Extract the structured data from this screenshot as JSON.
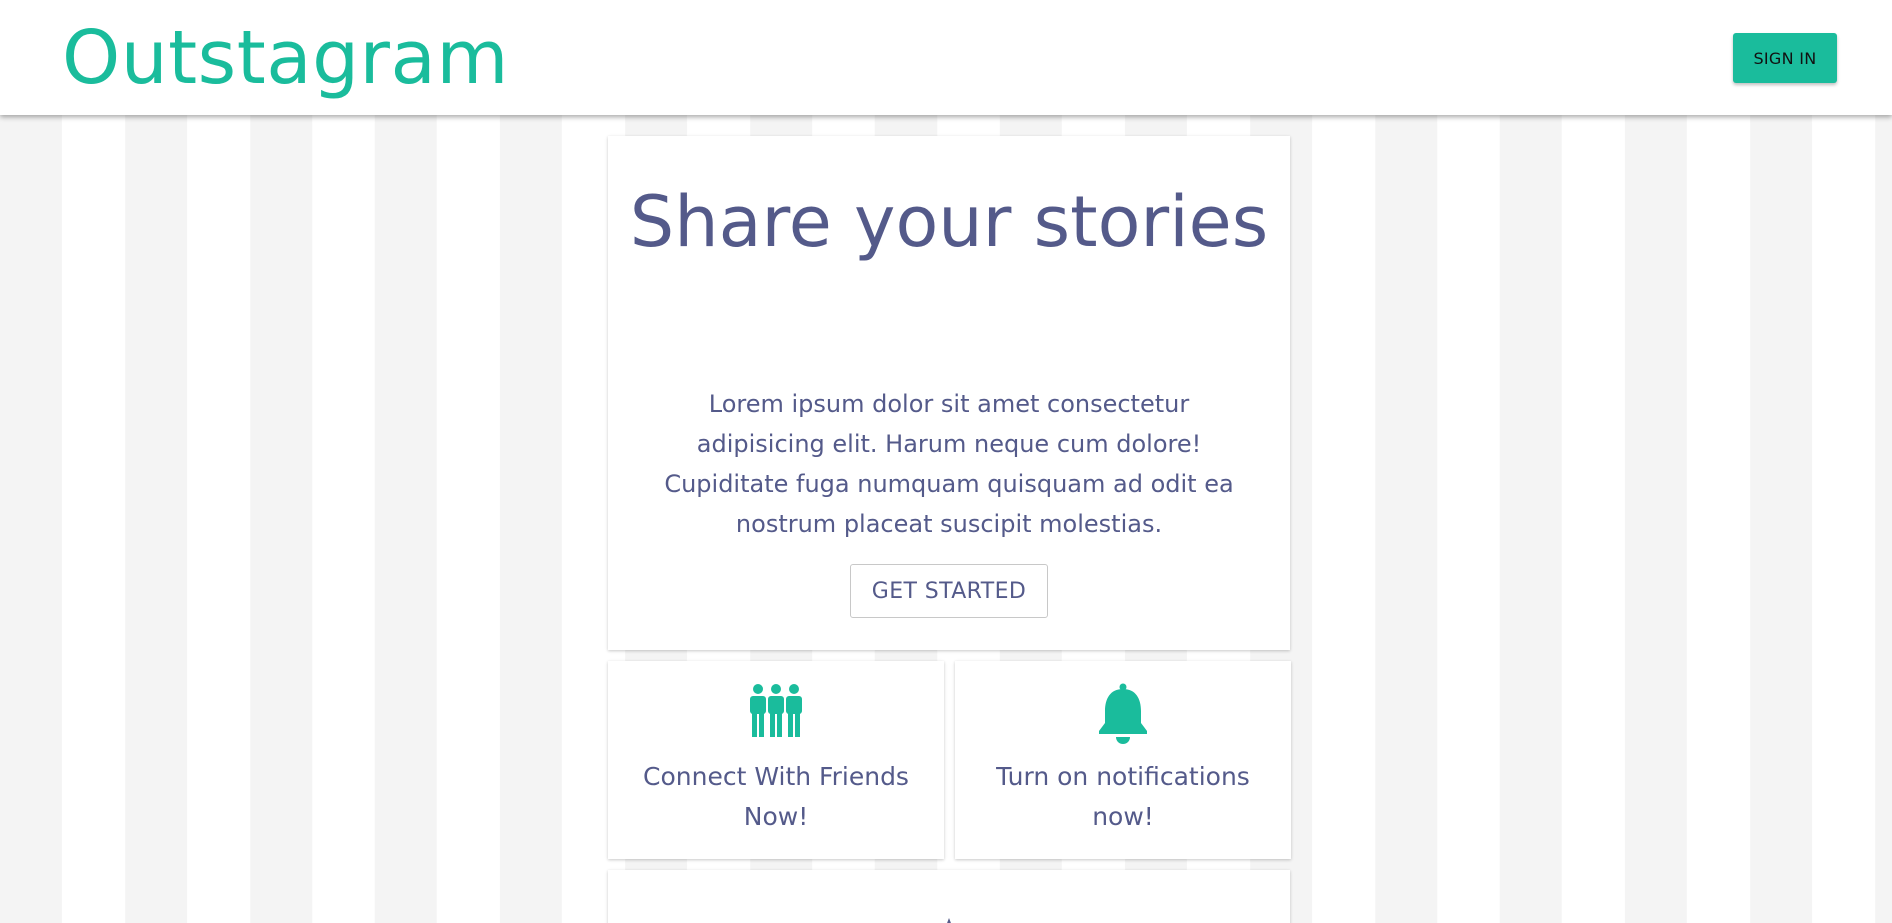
{
  "header": {
    "brand": "Outstagram",
    "signin_label": "SIGN IN"
  },
  "hero": {
    "title": "Share your stories",
    "text": "Lorem ipsum dolor sit amet consectetur adipisicing elit. Harum neque cum dolore! Cupiditate fuga numquam quisquam ad odit ea nostrum placeat suscipit molestias.",
    "cta_label": "GET STARTED"
  },
  "features": [
    {
      "icon": "people-group-icon",
      "text": "Connect With Friends Now!"
    },
    {
      "icon": "bell-icon",
      "text": "Turn on notifications now!"
    }
  ],
  "bottom_card": {
    "icon": "star-icon"
  },
  "colors": {
    "brand": "#1abc9c",
    "text": "#545a8a",
    "stripe": "#f4f4f4"
  }
}
